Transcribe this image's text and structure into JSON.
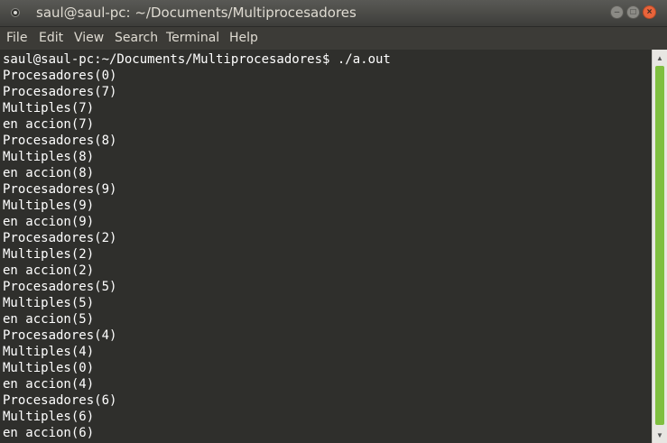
{
  "window": {
    "title": "saul@saul-pc: ~/Documents/Multiprocesadores"
  },
  "menu": {
    "items": [
      "File",
      "Edit",
      "View",
      "Search",
      "Terminal",
      "Help"
    ]
  },
  "terminal": {
    "prompt": "saul@saul-pc:~/Documents/Multiprocesadores$ ./a.out",
    "lines": [
      "Procesadores(0)",
      "Procesadores(7)",
      "Multiples(7)",
      "en accion(7)",
      "Procesadores(8)",
      "Multiples(8)",
      "en accion(8)",
      "Procesadores(9)",
      "Multiples(9)",
      "en accion(9)",
      "Procesadores(2)",
      "Multiples(2)",
      "en accion(2)",
      "Procesadores(5)",
      "Multiples(5)",
      "en accion(5)",
      "Procesadores(4)",
      "Multiples(4)",
      "Multiples(0)",
      "en accion(4)",
      "Procesadores(6)",
      "Multiples(6)",
      "en accion(6)"
    ]
  },
  "colors": {
    "accent_scrollbar": "#7fbf3f",
    "close_button": "#e9643b",
    "terminal_bg": "#2f2f2c"
  },
  "icons": {
    "window_min": "minimize-icon",
    "window_max": "maximize-icon",
    "window_close": "close-icon",
    "scroll_up": "arrow-up-icon",
    "scroll_down": "arrow-down-icon"
  }
}
